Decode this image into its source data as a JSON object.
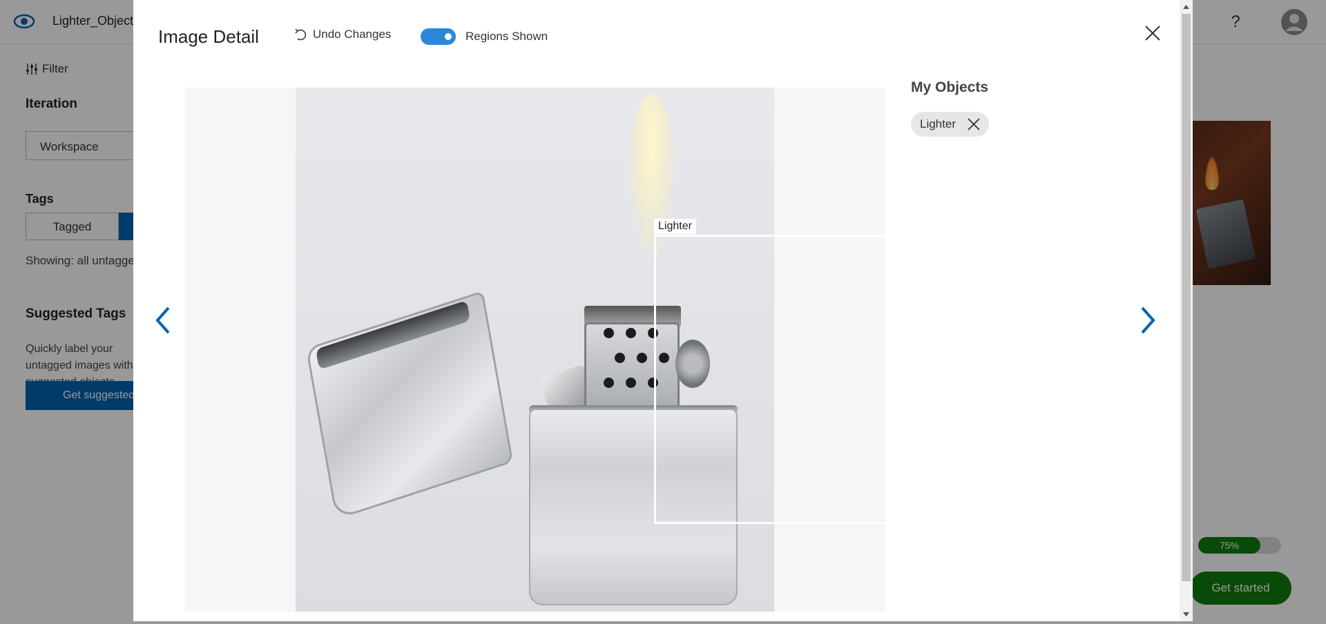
{
  "app": {
    "title": "Lighter_Object",
    "help_symbol": "?"
  },
  "sidebar": {
    "filter_label": "Filter",
    "iteration_heading": "Iteration",
    "iteration_value": "Workspace",
    "tags_heading": "Tags",
    "tag_tabs": [
      "Tagged",
      ""
    ],
    "showing_text": "Showing: all untagged",
    "suggested_heading": "Suggested Tags",
    "suggested_desc": "Quickly label your untagged images with suggested objects",
    "suggested_button": "Get suggested objects"
  },
  "background_panel": {
    "progress": 75,
    "progress_label": "75%",
    "get_started_label": "Get started"
  },
  "modal": {
    "title": "Image Detail",
    "undo_label": "Undo Changes",
    "regions_label": "Regions Shown",
    "regions_on": true,
    "region_label": "Lighter",
    "my_objects_title": "My Objects",
    "objects": [
      {
        "label": "Lighter"
      }
    ]
  },
  "colors": {
    "accent": "#0063b1",
    "toggle": "#2b88d8",
    "success": "#107c10"
  },
  "icons": {
    "logo": "eye-icon",
    "filter": "sliders-icon",
    "undo": "undo-icon",
    "close": "close-icon",
    "prev": "chevron-left-icon",
    "next": "chevron-right-icon",
    "remove_tag": "close-icon",
    "help": "question-icon",
    "avatar": "user-avatar-icon"
  }
}
